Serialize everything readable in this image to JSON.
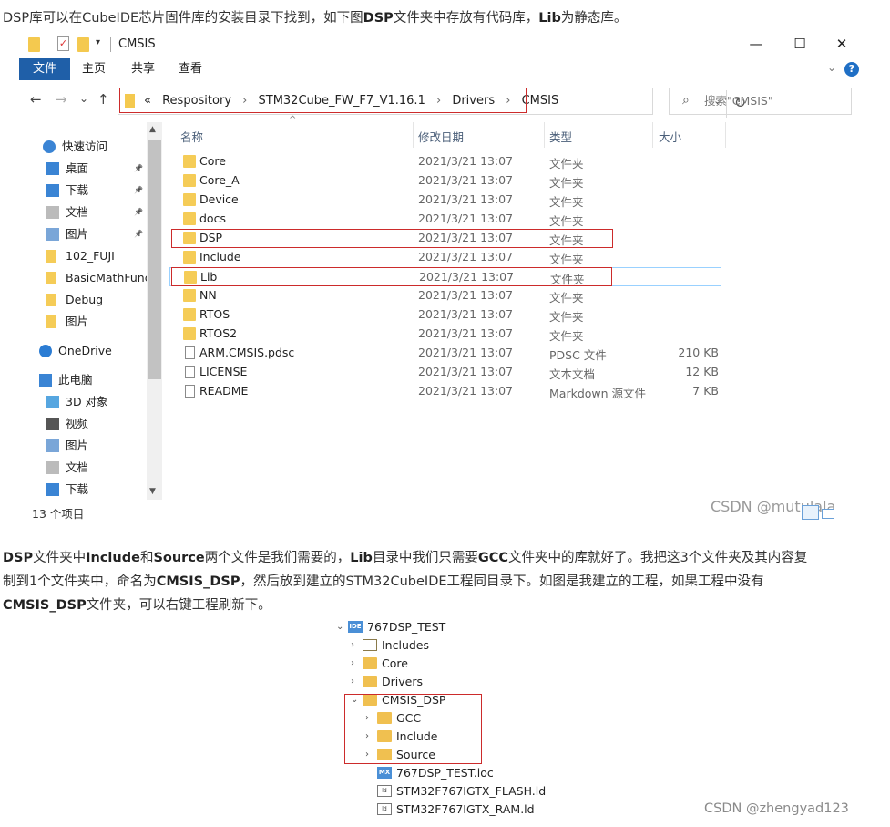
{
  "intro_text": [
    "DSP库可以在CubeIDE芯片固件库的安装目录下找到，如下图",
    "DSP",
    "文件夹中存放有代码库，",
    "Lib",
    "为静态库。"
  ],
  "explorer": {
    "window_title": "CMSIS",
    "window_buttons": {
      "minimize": "—",
      "maximize": "☐",
      "close": "✕"
    },
    "ribbon_tabs": [
      "文件",
      "主页",
      "共享",
      "查看"
    ],
    "help": "?",
    "nav": {
      "back": "←",
      "forward": "→",
      "recent": "⌄",
      "up": "↑"
    },
    "address": {
      "prefix": "«",
      "crumbs": [
        "Respository",
        "STM32Cube_FW_F7_V1.16.1",
        "Drivers",
        "CMSIS"
      ],
      "separator": "›"
    },
    "refresh": "↻",
    "search_placeholder": "搜索\"CMSIS\"",
    "sidebar": [
      {
        "label": "快速访问",
        "icon": "star-icon",
        "pinned": false
      },
      {
        "label": "桌面",
        "icon": "desktop-icon",
        "pinned": true
      },
      {
        "label": "下载",
        "icon": "download-icon",
        "pinned": true
      },
      {
        "label": "文档",
        "icon": "document-icon",
        "pinned": true
      },
      {
        "label": "图片",
        "icon": "picture-icon",
        "pinned": true
      },
      {
        "label": "102_FUJI",
        "icon": "folder-icon",
        "pinned": false
      },
      {
        "label": "BasicMathFunc",
        "icon": "folder-icon",
        "pinned": false
      },
      {
        "label": "Debug",
        "icon": "folder-icon",
        "pinned": false
      },
      {
        "label": "图片",
        "icon": "folder-icon",
        "pinned": false
      },
      {
        "label": "OneDrive",
        "icon": "cloud-icon",
        "pinned": false
      },
      {
        "label": "此电脑",
        "icon": "computer-icon",
        "pinned": false
      },
      {
        "label": "3D 对象",
        "icon": "cube-icon",
        "pinned": false
      },
      {
        "label": "视频",
        "icon": "video-icon",
        "pinned": false
      },
      {
        "label": "图片",
        "icon": "picture-icon",
        "pinned": false
      },
      {
        "label": "文档",
        "icon": "document-icon",
        "pinned": false
      },
      {
        "label": "下载",
        "icon": "download-icon",
        "pinned": false
      }
    ],
    "status": "13 个项目",
    "columns": {
      "name": "名称",
      "date": "修改日期",
      "type": "类型",
      "size": "大小"
    },
    "files": [
      {
        "name": "Core",
        "date": "2021/3/21 13:07",
        "type": "文件夹",
        "size": "",
        "kind": "folder"
      },
      {
        "name": "Core_A",
        "date": "2021/3/21 13:07",
        "type": "文件夹",
        "size": "",
        "kind": "folder"
      },
      {
        "name": "Device",
        "date": "2021/3/21 13:07",
        "type": "文件夹",
        "size": "",
        "kind": "folder"
      },
      {
        "name": "docs",
        "date": "2021/3/21 13:07",
        "type": "文件夹",
        "size": "",
        "kind": "folder"
      },
      {
        "name": "DSP",
        "date": "2021/3/21 13:07",
        "type": "文件夹",
        "size": "",
        "kind": "folder"
      },
      {
        "name": "Include",
        "date": "2021/3/21 13:07",
        "type": "文件夹",
        "size": "",
        "kind": "folder"
      },
      {
        "name": "Lib",
        "date": "2021/3/21 13:07",
        "type": "文件夹",
        "size": "",
        "kind": "folder"
      },
      {
        "name": "NN",
        "date": "2021/3/21 13:07",
        "type": "文件夹",
        "size": "",
        "kind": "folder"
      },
      {
        "name": "RTOS",
        "date": "2021/3/21 13:07",
        "type": "文件夹",
        "size": "",
        "kind": "folder"
      },
      {
        "name": "RTOS2",
        "date": "2021/3/21 13:07",
        "type": "文件夹",
        "size": "",
        "kind": "folder"
      },
      {
        "name": "ARM.CMSIS.pdsc",
        "date": "2021/3/21 13:07",
        "type": "PDSC 文件",
        "size": "210 KB",
        "kind": "file"
      },
      {
        "name": "LICENSE",
        "date": "2021/3/21 13:07",
        "type": "文本文档",
        "size": "12 KB",
        "kind": "file"
      },
      {
        "name": "README",
        "date": "2021/3/21 13:07",
        "type": "Markdown 源文件",
        "size": "7 KB",
        "kind": "file"
      }
    ],
    "watermark": "CSDN @mutulala"
  },
  "para2": {
    "line1": [
      "DSP",
      "文件夹中",
      "Include",
      "和",
      "Source",
      "两个文件是我们需要的，",
      "Lib",
      "目录中我们只需要",
      "GCC",
      "文件夹中的库就好了。我把这3个文件夹及其内容复"
    ],
    "line2": [
      "制到1个文件夹中，命名为",
      "CMSIS_DSP",
      "，然后放到建立的STM32CubeIDE工程同目录下。如图是我建立的工程，如果工程中没有"
    ],
    "line3": [
      "CMSIS_DSP",
      "文件夹，可以右键工程刷新下。"
    ]
  },
  "tree": {
    "nodes": [
      {
        "label": "767DSP_TEST",
        "depth": 0,
        "chevron": "⌄",
        "icon": "ide-project-icon",
        "badge": "IDE"
      },
      {
        "label": "Includes",
        "depth": 1,
        "chevron": "›",
        "icon": "includes-icon",
        "badge": ""
      },
      {
        "label": "Core",
        "depth": 1,
        "chevron": "›",
        "icon": "folder-icon",
        "badge": ""
      },
      {
        "label": "Drivers",
        "depth": 1,
        "chevron": "›",
        "icon": "folder-icon",
        "badge": ""
      },
      {
        "label": "CMSIS_DSP",
        "depth": 1,
        "chevron": "⌄",
        "icon": "folder-icon",
        "badge": ""
      },
      {
        "label": "GCC",
        "depth": 2,
        "chevron": "›",
        "icon": "folder-icon",
        "badge": ""
      },
      {
        "label": "Include",
        "depth": 2,
        "chevron": "›",
        "icon": "folder-icon",
        "badge": ""
      },
      {
        "label": "Source",
        "depth": 2,
        "chevron": "›",
        "icon": "folder-icon",
        "badge": ""
      },
      {
        "label": "767DSP_TEST.ioc",
        "depth": 1,
        "chevron": "",
        "icon": "mx-file-icon",
        "badge": "MX"
      },
      {
        "label": "STM32F767IGTX_FLASH.ld",
        "depth": 1,
        "chevron": "",
        "icon": "ld-file-icon",
        "badge": "ld"
      },
      {
        "label": "STM32F767IGTX_RAM.ld",
        "depth": 1,
        "chevron": "",
        "icon": "ld-file-icon",
        "badge": "ld"
      }
    ],
    "watermark": "CSDN @zhengyad123"
  },
  "colors": {
    "accent": "#1f5fa8",
    "highlight": "#cc2b2b",
    "folder": "#f5cc57"
  }
}
